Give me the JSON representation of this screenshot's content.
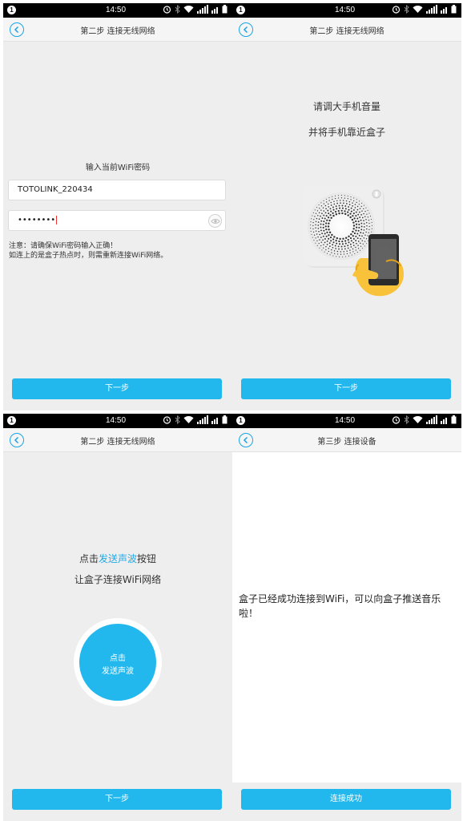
{
  "status_bar": {
    "time": "14:50",
    "notification": "1"
  },
  "screens": [
    {
      "title": "第二步 连接无线网络",
      "prompt": "输入当前WiFi密码",
      "ssid_value": "TOTOLINK_220434",
      "password_value": "••••••••",
      "note_line1": "注意：请确保WiFi密码输入正确！",
      "note_line2": "如连上的是盒子热点时，则需重新连接WiFi网络。",
      "button": "下一步"
    },
    {
      "title": "第二步 连接无线网络",
      "line1": "请调大手机音量",
      "line2": "并将手机靠近盒子",
      "button": "下一步"
    },
    {
      "title": "第二步 连接无线网络",
      "line1_prefix": "点击",
      "line1_highlight": "发送声波",
      "line1_suffix": "按钮",
      "line2": "让盒子连接WiFi网络",
      "sound_button_line1": "点击",
      "sound_button_line2": "发送声波",
      "button": "下一步"
    },
    {
      "title": "第三步 连接设备",
      "success_message": "盒子已经成功连接到WiFi，可以向盒子推送音乐啦！",
      "button": "连接成功"
    }
  ],
  "icons": [
    "back-arrow-icon",
    "alarm-icon",
    "bluetooth-icon",
    "wifi-icon",
    "signal-icon",
    "battery-icon",
    "eye-icon"
  ],
  "colors": {
    "accent": "#22b8ee",
    "highlight": "#22a9e6",
    "background": "#eeeeee"
  }
}
